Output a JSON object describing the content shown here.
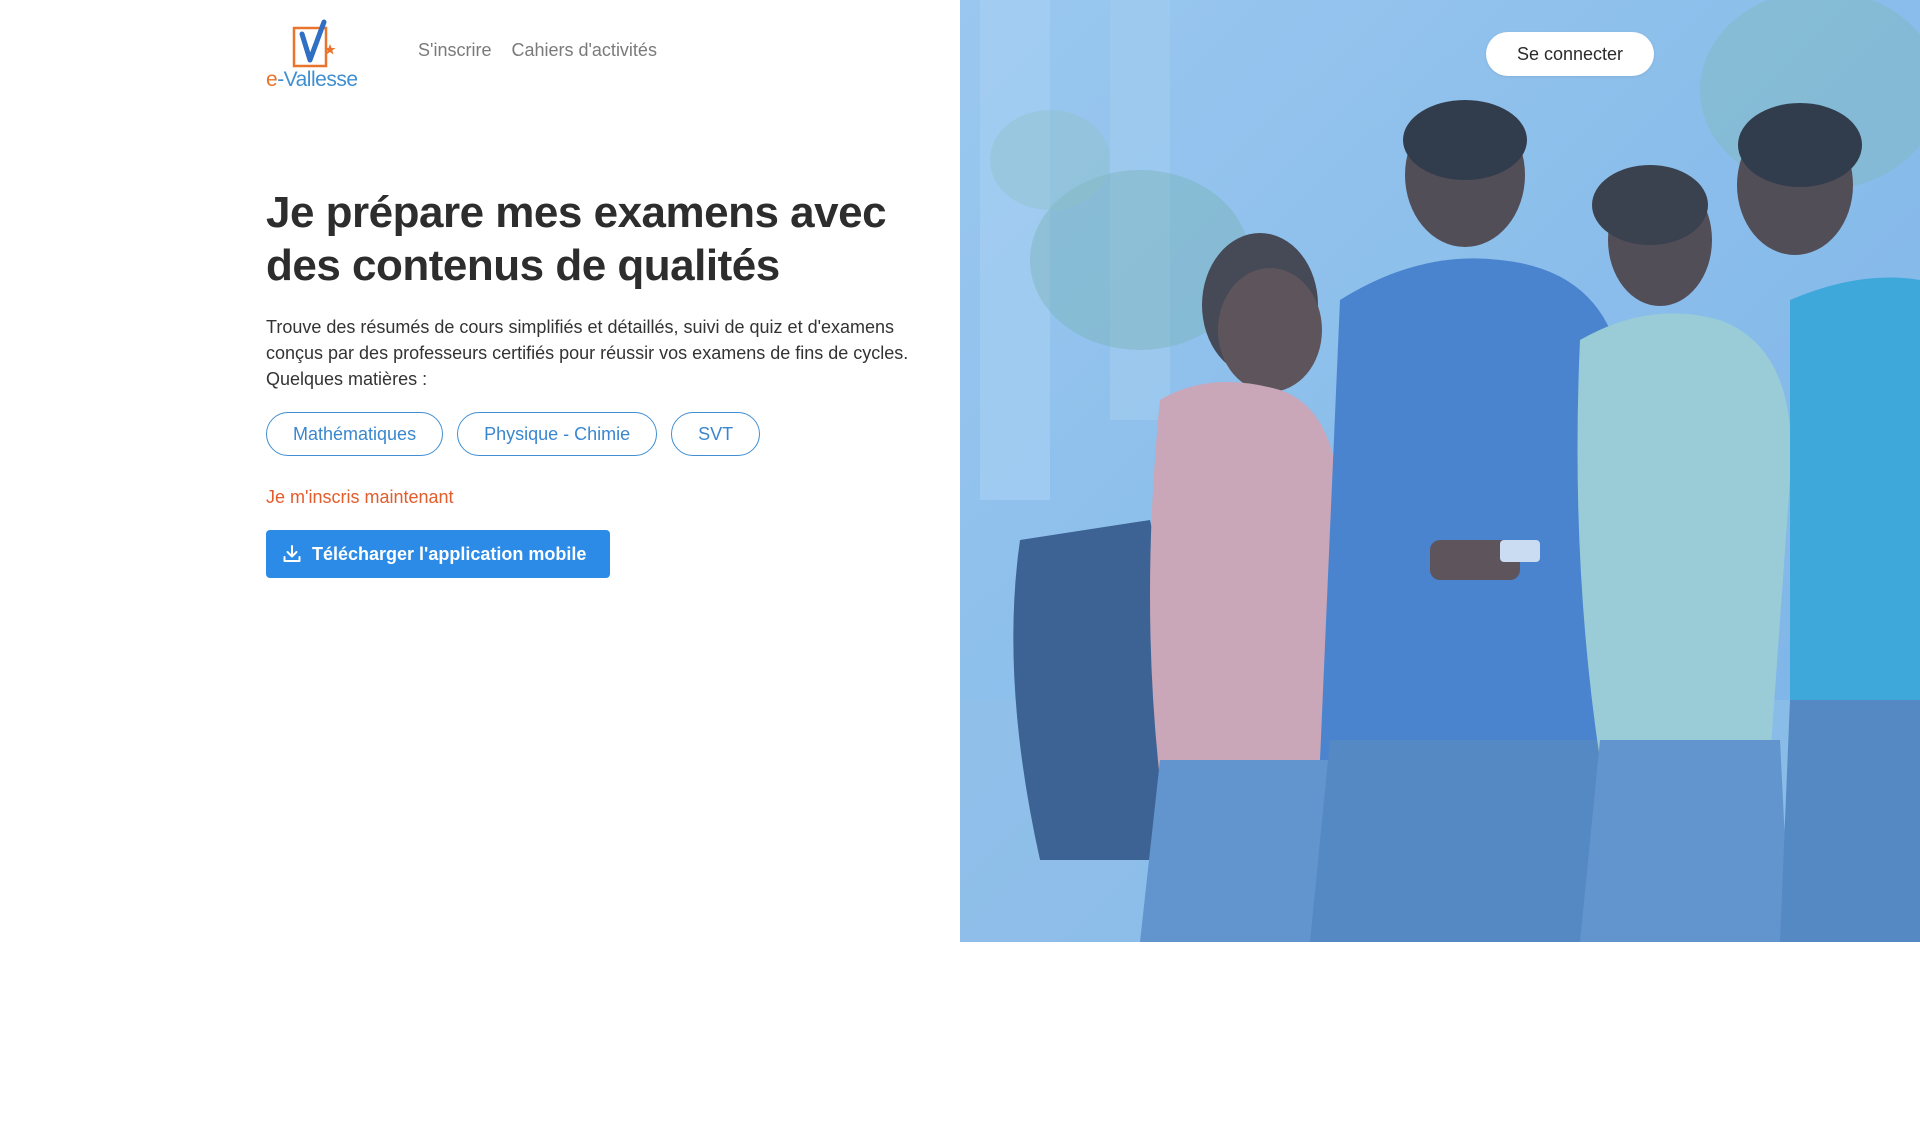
{
  "brand": {
    "logo_prefix": "e",
    "logo_suffix": "-Vallesse",
    "logo_mark_color": "#3f8fd2",
    "logo_accent_color": "#e8742e"
  },
  "nav": {
    "items": [
      {
        "label": "S'inscrire"
      },
      {
        "label": "Cahiers d'activités"
      }
    ]
  },
  "header": {
    "login_label": "Se connecter"
  },
  "hero": {
    "title": "Je prépare mes examens avec des contenus de qualités",
    "description": "Trouve des résumés de cours simplifiés et détaillés, suivi de quiz et d'examens conçus par des professeurs certifiés pour réussir vos examens de fins de cycles. Quelques matières :",
    "subjects": [
      {
        "label": "Mathématiques"
      },
      {
        "label": "Physique - Chimie"
      },
      {
        "label": "SVT"
      }
    ],
    "signup_link": "Je m'inscris maintenant",
    "download_button": "Télécharger l'application mobile",
    "download_icon": "download-icon",
    "image": "students-looking-at-phone",
    "image_tint": "#8ec0ec"
  },
  "colors": {
    "primary": "#2b8be6",
    "accent": "#e25c2c",
    "pill_border": "#3f8fd2",
    "text_dark": "#2d2d2d"
  }
}
